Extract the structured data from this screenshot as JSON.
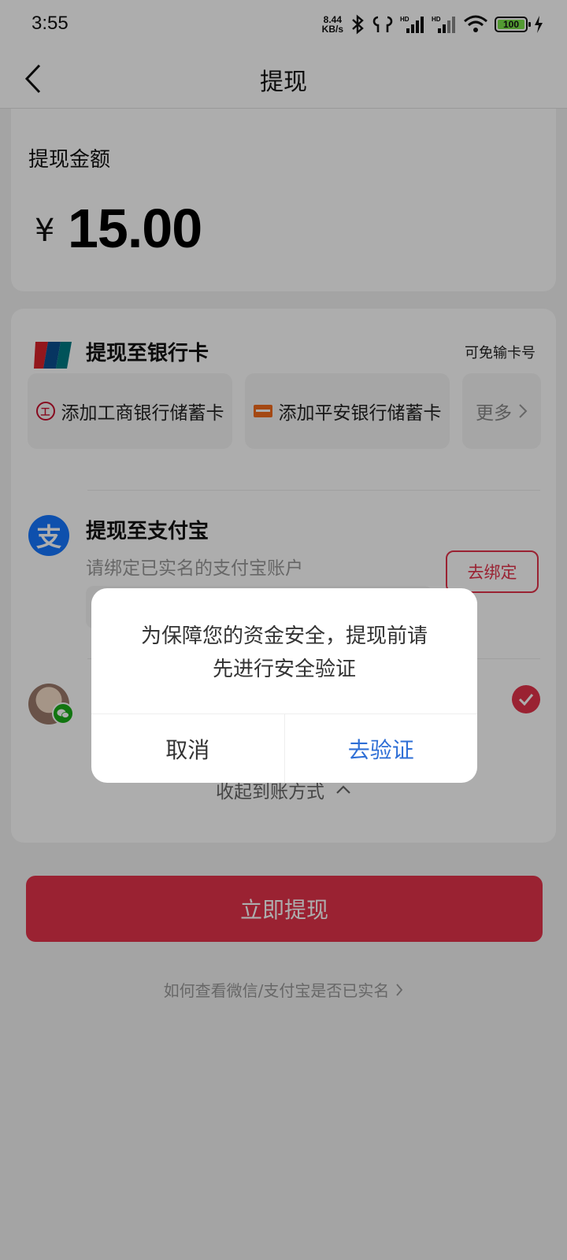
{
  "status_bar": {
    "time": "3:55",
    "speed_value": "8.44",
    "speed_unit": "KB/s",
    "battery": "100"
  },
  "nav": {
    "title": "提现"
  },
  "amount": {
    "label": "提现金额",
    "currency": "¥",
    "value": "15.00"
  },
  "bank": {
    "title": "提现至银行卡",
    "note": "可免输卡号",
    "chips": [
      {
        "label": "添加工商银行储蓄卡"
      },
      {
        "label": "添加平安银行储蓄卡"
      },
      {
        "label": "更多"
      }
    ]
  },
  "alipay": {
    "title": "提现至支付宝",
    "hint": "请绑定已实名的支付宝账户",
    "bind_label": "去绑定"
  },
  "collapse_label": "收起到账方式",
  "withdraw_label": "立即提现",
  "help_link": "如何查看微信/支付宝是否已实名",
  "dialog": {
    "message_line1": "为保障您的资金安全，提现前请",
    "message_line2": "先进行安全验证",
    "cancel_label": "取消",
    "confirm_label": "去验证"
  },
  "colors": {
    "accent": "#e3334b",
    "link": "#2f6fd6"
  }
}
